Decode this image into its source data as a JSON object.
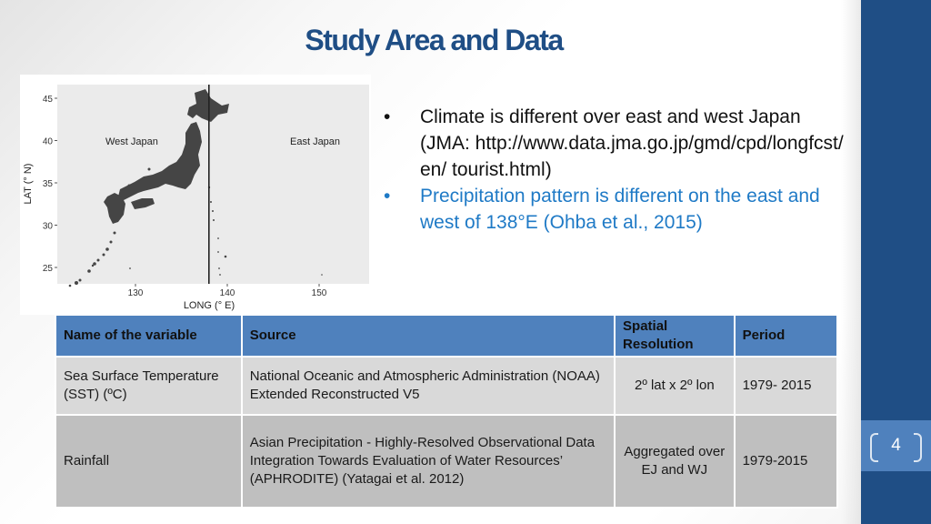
{
  "slide": {
    "title": "Study Area and Data",
    "page_number": "4"
  },
  "colors": {
    "title": "#1f4e85",
    "sidebar": "#1f4e85",
    "page_box": "#4f81bd",
    "table_header": "#4f81bd",
    "row1": "#d9d9d9",
    "row2": "#bfbfbf",
    "bullet2": "#1f7ac6"
  },
  "map": {
    "ylabel": "LAT (° N)",
    "xlabel": "LONG (° E)",
    "yticks": [
      "45",
      "40",
      "35",
      "30",
      "25"
    ],
    "xticks": [
      "130",
      "140",
      "150"
    ],
    "divider_longitude": 138,
    "label_west": "West Japan",
    "label_east": "East Japan"
  },
  "bullets": [
    {
      "marker": "•",
      "text": "Climate is different over east and west Japan (JMA: http://www.data.jma.go.jp/gmd/cpd/longfcst/ en/ tourist.html)"
    },
    {
      "marker": "•",
      "text": "Precipitation pattern is different on the east and west of 138°E (Ohba et al., 2015)"
    }
  ],
  "table": {
    "headers": [
      "Name of the variable",
      "Source",
      "Spatial Resolution",
      "Period"
    ],
    "rows": [
      [
        "Sea Surface Temperature (SST) (ºC)",
        "National Oceanic and Atmospheric Administration (NOAA) Extended Reconstructed V5",
        "2º lat x 2º lon",
        "1979- 2015"
      ],
      [
        "Rainfall",
        "Asian Precipitation - Highly-Resolved Observational Data Integration Towards Evaluation of Water Resources’ (APHRODITE) (Yatagai et al. 2012)",
        "Aggregated over EJ and WJ",
        "1979-2015"
      ]
    ]
  }
}
